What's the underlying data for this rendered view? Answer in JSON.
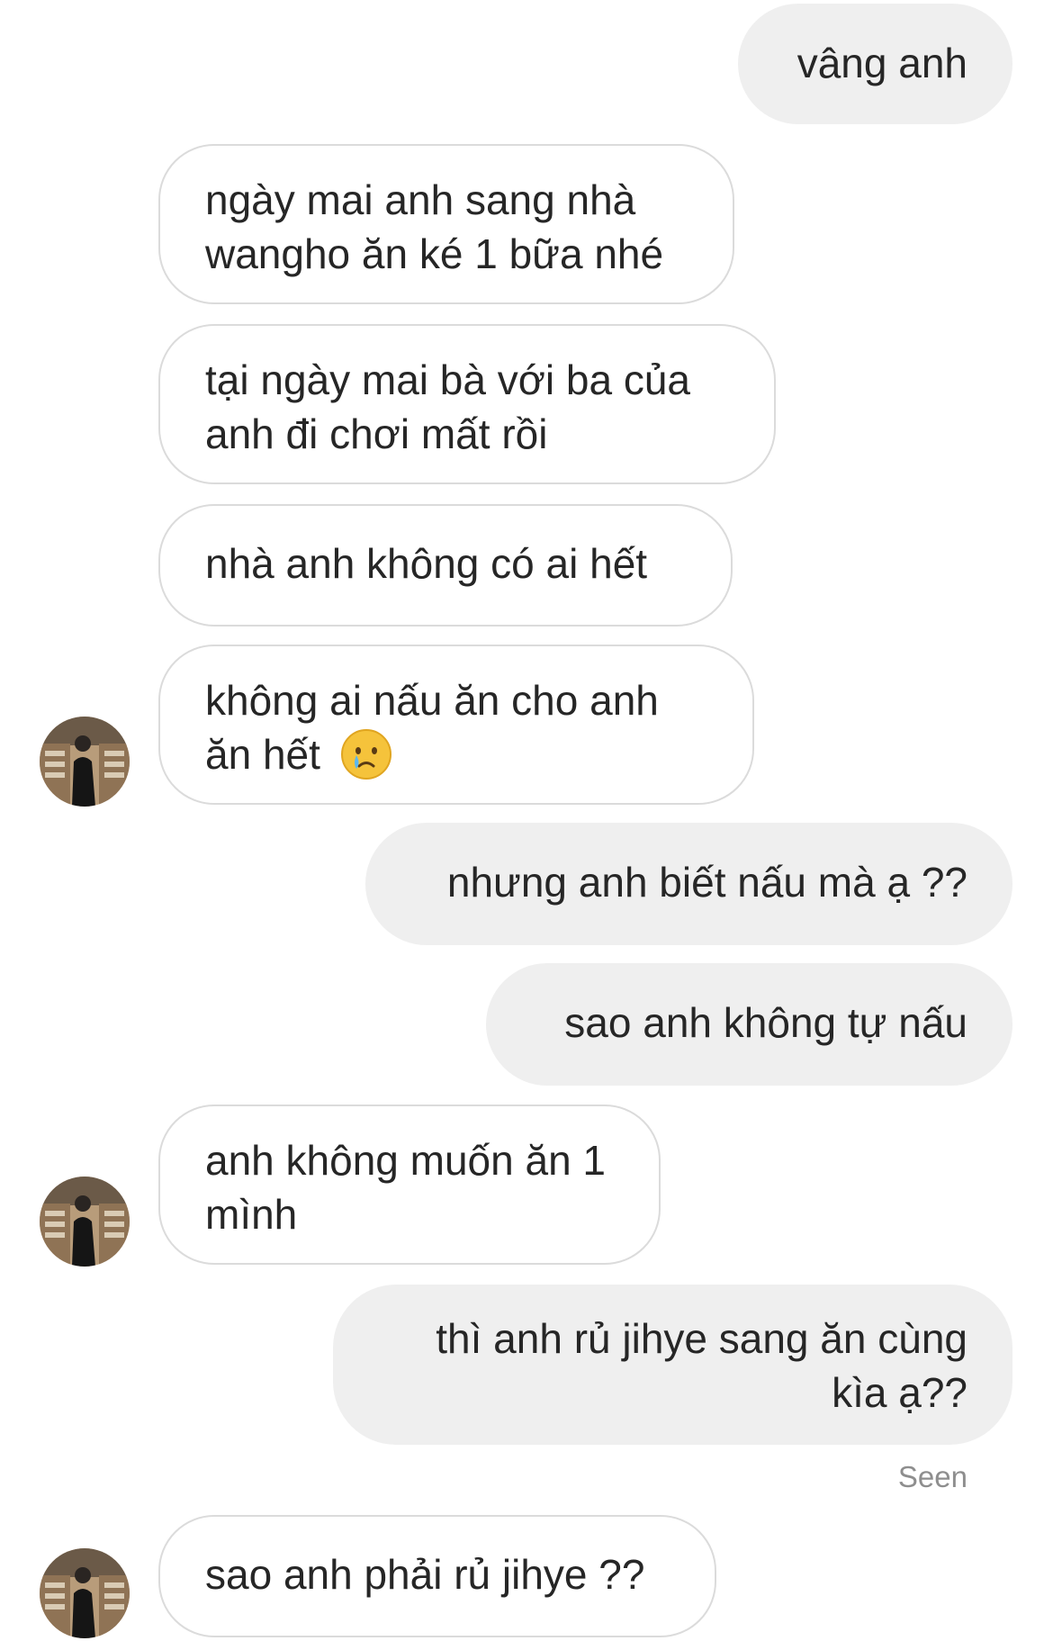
{
  "conversation": {
    "messages": [
      {
        "id": "m1",
        "side": "out",
        "text": "vâng anh"
      },
      {
        "id": "m2",
        "side": "in",
        "text": "ngày mai anh sang nhà wangho ăn ké 1 bữa nhé"
      },
      {
        "id": "m3",
        "side": "in",
        "text": "tại ngày mai bà với ba của anh đi chơi mất rồi"
      },
      {
        "id": "m4",
        "side": "in",
        "text": "nhà anh không có ai hết"
      },
      {
        "id": "m5",
        "side": "in",
        "text": "không ai nấu ăn cho anh ăn hết",
        "emoji": "crying-face-icon"
      },
      {
        "id": "m6",
        "side": "out",
        "text": "nhưng anh biết nấu mà ạ ??"
      },
      {
        "id": "m7",
        "side": "out",
        "text": "sao anh không tự nấu"
      },
      {
        "id": "m8",
        "side": "in",
        "text": "anh không muốn ăn 1 mình"
      },
      {
        "id": "m9",
        "side": "out",
        "text": "thì anh rủ jihye sang ăn cùng kìa ạ??"
      },
      {
        "id": "m10",
        "side": "in",
        "text": "sao anh phải rủ jihye ??"
      }
    ],
    "seen_label": "Seen"
  },
  "colors": {
    "outgoing_bubble": "#efefef",
    "incoming_border": "#dbdbdb",
    "text": "#262626",
    "seen": "#8e8e8e"
  }
}
